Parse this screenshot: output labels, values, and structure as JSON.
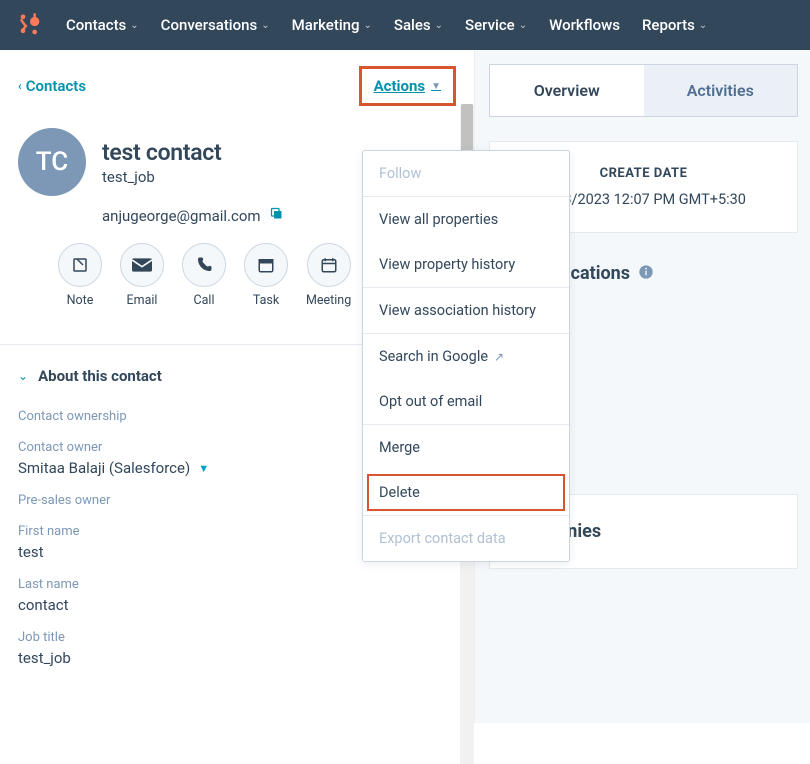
{
  "nav": {
    "items": [
      {
        "label": "Contacts"
      },
      {
        "label": "Conversations"
      },
      {
        "label": "Marketing"
      },
      {
        "label": "Sales"
      },
      {
        "label": "Service"
      },
      {
        "label": "Workflows"
      },
      {
        "label": "Reports"
      }
    ]
  },
  "left": {
    "back": "Contacts",
    "actions_label": "Actions"
  },
  "contact": {
    "initials": "TC",
    "name": "test contact",
    "job": "test_job",
    "email": "anjugeorge@gmail.com"
  },
  "quick_actions": [
    {
      "label": "Note",
      "icon": "note"
    },
    {
      "label": "Email",
      "icon": "mail"
    },
    {
      "label": "Call",
      "icon": "phone"
    },
    {
      "label": "Task",
      "icon": "task"
    },
    {
      "label": "Meeting",
      "icon": "meeting"
    }
  ],
  "about": {
    "title": "About this contact",
    "ownership_label": "Contact ownership",
    "owner_label": "Contact owner",
    "owner_value": "Smitaa Balaji (Salesforce)",
    "presales_label": "Pre-sales owner",
    "firstname_label": "First name",
    "firstname_value": "test",
    "lastname_label": "Last name",
    "lastname_value": "contact",
    "jobtitle_label": "Job title",
    "jobtitle_value": "test_job"
  },
  "dropdown": {
    "follow": "Follow",
    "view_all": "View all properties",
    "view_hist": "View property history",
    "view_assoc": "View association history",
    "search_google": "Search in Google",
    "opt_out": "Opt out of email",
    "merge": "Merge",
    "delete": "Delete",
    "export": "Export contact data"
  },
  "right": {
    "tabs": [
      {
        "label": "Overview"
      },
      {
        "label": "Activities"
      }
    ],
    "create_label": "CREATE DATE",
    "create_value": "5/23/2023 12:07 PM GMT+5:30",
    "communications": "communications",
    "companies": "Companies"
  }
}
